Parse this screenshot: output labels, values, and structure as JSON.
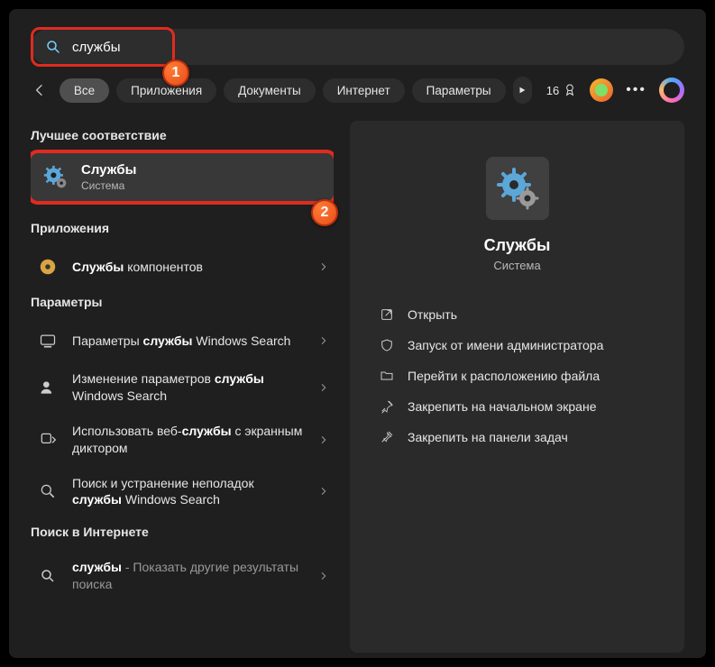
{
  "search": {
    "value": "службы"
  },
  "tabs": [
    {
      "label": "Все",
      "active": true
    },
    {
      "label": "Приложения"
    },
    {
      "label": "Документы"
    },
    {
      "label": "Интернет"
    },
    {
      "label": "Параметры"
    }
  ],
  "header": {
    "points": "16"
  },
  "badges": {
    "one": "1",
    "two": "2"
  },
  "best_match": {
    "section": "Лучшее соответствие",
    "title": "Службы",
    "subtitle": "Система"
  },
  "apps": {
    "section": "Приложения",
    "item1_pre": "Службы",
    "item1_post": " компонентов"
  },
  "params": {
    "section": "Параметры",
    "p1_pre": "Параметры ",
    "p1_b": "службы",
    "p1_post": " Windows Search",
    "p2_pre": "Изменение параметров ",
    "p2_b": "службы",
    "p2_post": " Windows Search",
    "p3_pre": "Использовать веб-",
    "p3_b": "службы",
    "p3_post": " с экранным диктором",
    "p4_pre": "Поиск и устранение неполадок ",
    "p4_b": "службы",
    "p4_post": " Windows Search"
  },
  "web": {
    "section": "Поиск в Интернете",
    "w1_b": "службы",
    "w1_post": " - Показать другие результаты поиска"
  },
  "panel": {
    "title": "Службы",
    "subtitle": "Система",
    "actions": {
      "open": "Открыть",
      "admin": "Запуск от имени администратора",
      "location": "Перейти к расположению файла",
      "pin_start": "Закрепить на начальном экране",
      "pin_task": "Закрепить на панели задач"
    }
  }
}
